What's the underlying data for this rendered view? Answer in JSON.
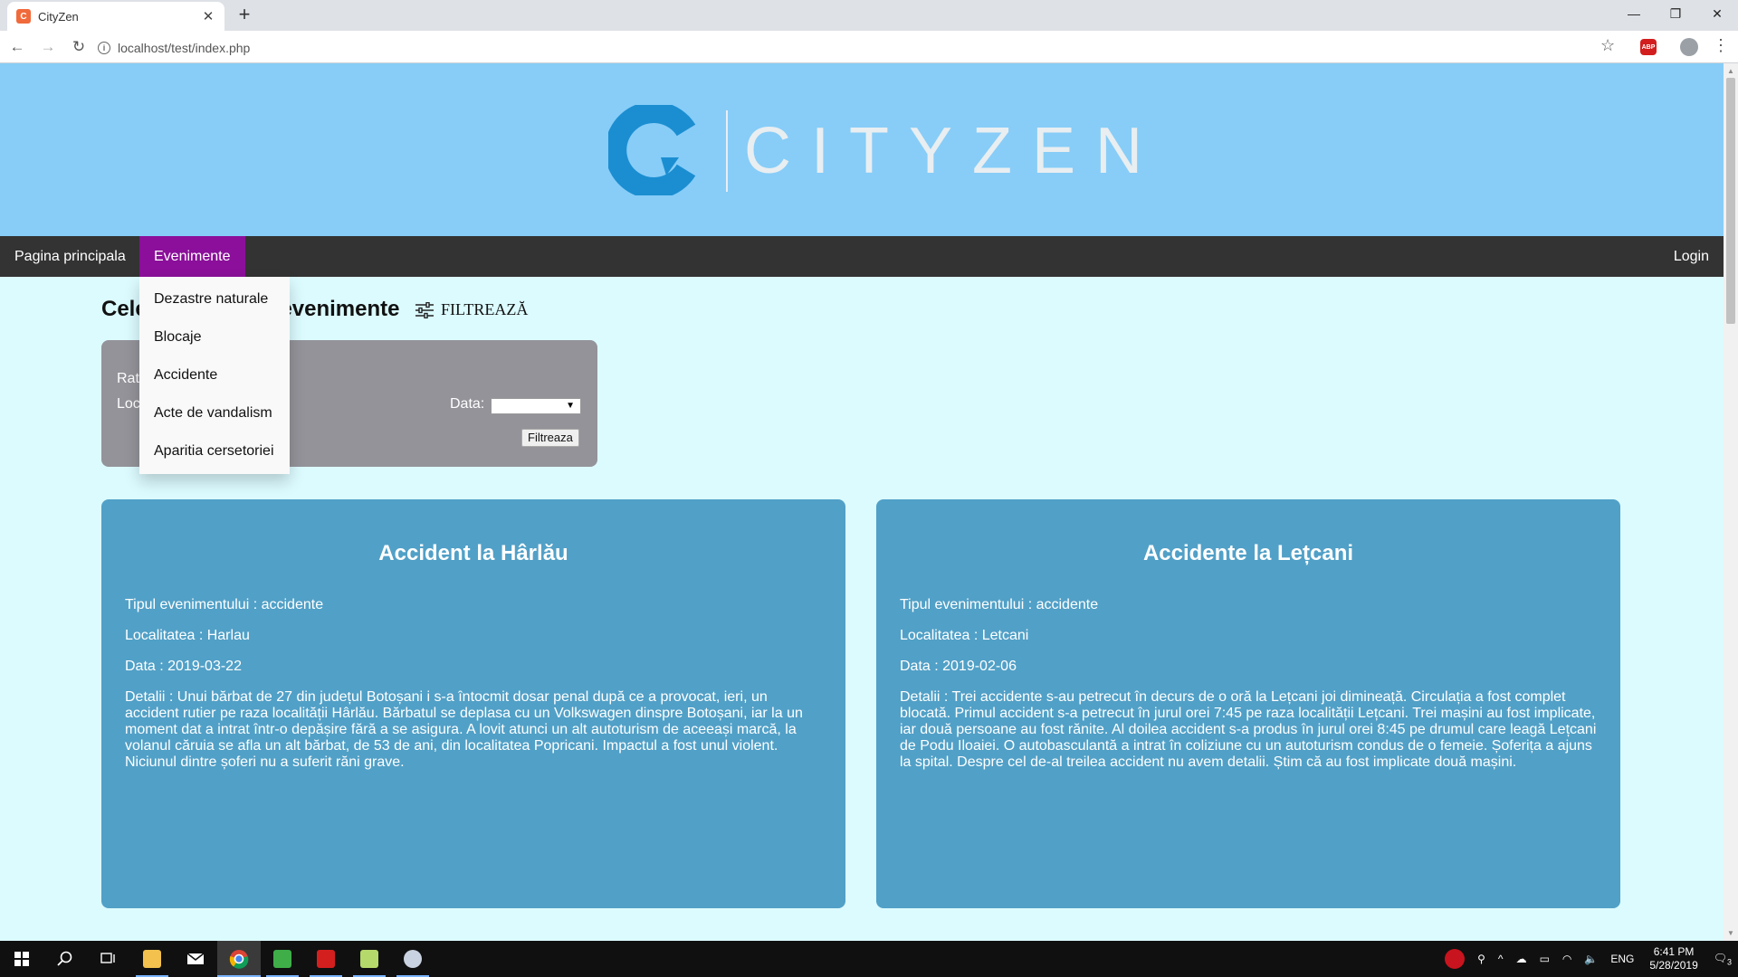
{
  "browser": {
    "tab_title": "CityZen",
    "tab_favicon_text": "C",
    "url": "localhost/test/index.php",
    "abp_label": "ABP"
  },
  "site": {
    "logo_text": "CITYZEN",
    "nav": {
      "home": "Pagina principala",
      "events": "Evenimente",
      "login": "Login"
    },
    "dropdown": [
      "Dezastre naturale",
      "Blocaje",
      "Accidente",
      "Acte de vandalism",
      "Aparitia cersetoriei"
    ],
    "heading": "Cele mai recente evenimente",
    "filter_toggle": "FILTREAZĂ",
    "filter_box": {
      "rating_label": "Rat",
      "location_label": "Loc",
      "date_label": "Data:",
      "date_value": "",
      "button": "Filtreaza"
    },
    "cards": [
      {
        "title": "Accident la Hârlău",
        "type": "Tipul evenimentului : accidente",
        "location": "Localitatea : Harlau",
        "date": "Data : 2019-03-22",
        "details": "Detalii : Unui bărbat de 27 din județul Botoșani i s-a întocmit dosar penal după ce a provocat, ieri, un accident rutier pe raza localității Hârlău. Bărbatul se deplasa cu un Volkswagen dinspre Botoșani, iar la un moment dat a intrat într-o depășire fără a se asigura. A lovit atunci un alt autoturism de aceeași marcă, la volanul căruia se afla un alt bărbat, de 53 de ani, din localitatea Popricani. Impactul a fost unul violent. Niciunul dintre șoferi nu a suferit răni grave."
      },
      {
        "title": "Accidente la Lețcani",
        "type": "Tipul evenimentului : accidente",
        "location": "Localitatea : Letcani",
        "date": "Data : 2019-02-06",
        "details": "Detalii : Trei accidente s-au petrecut în decurs de o oră la Lețcani joi dimineață. Circulația a fost complet blocată. Primul accident s-a petrecut în jurul orei 7:45 pe raza localității Lețcani. Trei mașini au fost implicate, iar două persoane au fost rănite. Al doilea accident s-a produs în jurul orei 8:45 pe drumul care leagă Lețcani de Podu Iloaiei. O autobasculantă a intrat în coliziune cu un autoturism condus de o femeie. Șoferița a ajuns la spital. Despre cel de-al treilea accident nu avem detalii. Știm că au fost implicate două mașini."
      }
    ]
  },
  "colors": {
    "header_bg": "#87cdf8",
    "nav_bg": "#333333",
    "nav_active": "#8b0f9a",
    "page_bg": "#dcfbff",
    "card_bg": "#51a0c7",
    "logo_blue": "#1b8ed1"
  },
  "taskbar": {
    "language": "ENG",
    "time": "6:41 PM",
    "date": "5/28/2019",
    "notifications": "3"
  }
}
